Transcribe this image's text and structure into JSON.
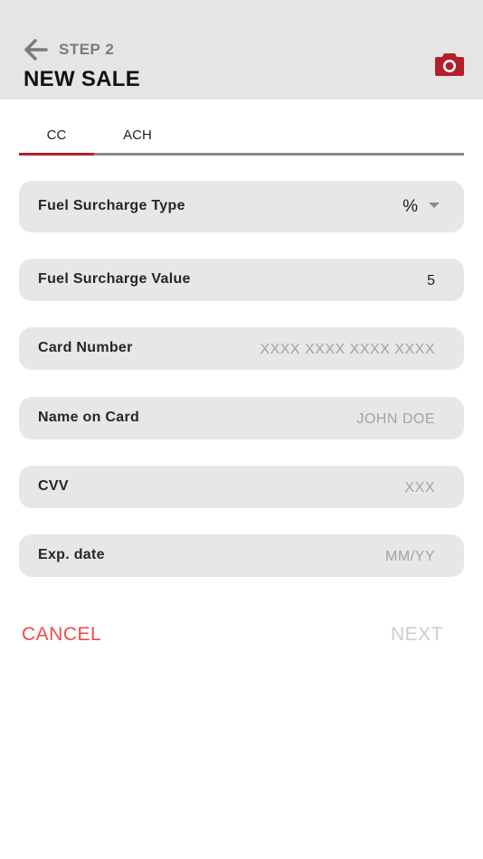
{
  "header": {
    "step_label": "STEP 2",
    "title": "NEW SALE",
    "back_icon": "arrow-left-icon",
    "camera_icon": "camera-icon",
    "camera_color": "#b3202a"
  },
  "tabs": [
    {
      "label": "CC",
      "active": true
    },
    {
      "label": "ACH",
      "active": false
    }
  ],
  "form": {
    "fuel_surcharge_type": {
      "label": "Fuel Surcharge Type",
      "value": "%"
    },
    "fuel_surcharge_value": {
      "label": "Fuel Surcharge Value",
      "value": "5"
    },
    "card_number": {
      "label": "Card Number",
      "placeholder": "XXXX XXXX XXXX XXXX"
    },
    "name_on_card": {
      "label": "Name on Card",
      "placeholder": "JOHN DOE"
    },
    "cvv": {
      "label": "CVV",
      "placeholder": "XXX"
    },
    "exp_date": {
      "label": "Exp. date",
      "placeholder": "MM/YY"
    }
  },
  "actions": {
    "cancel_label": "CANCEL",
    "next_label": "NEXT"
  },
  "colors": {
    "accent": "#b3202a",
    "cancel": "#ef4b4b",
    "disabled": "#cdcdcd",
    "field_bg": "#e7e7e7",
    "header_bg": "#e5e5e5"
  }
}
